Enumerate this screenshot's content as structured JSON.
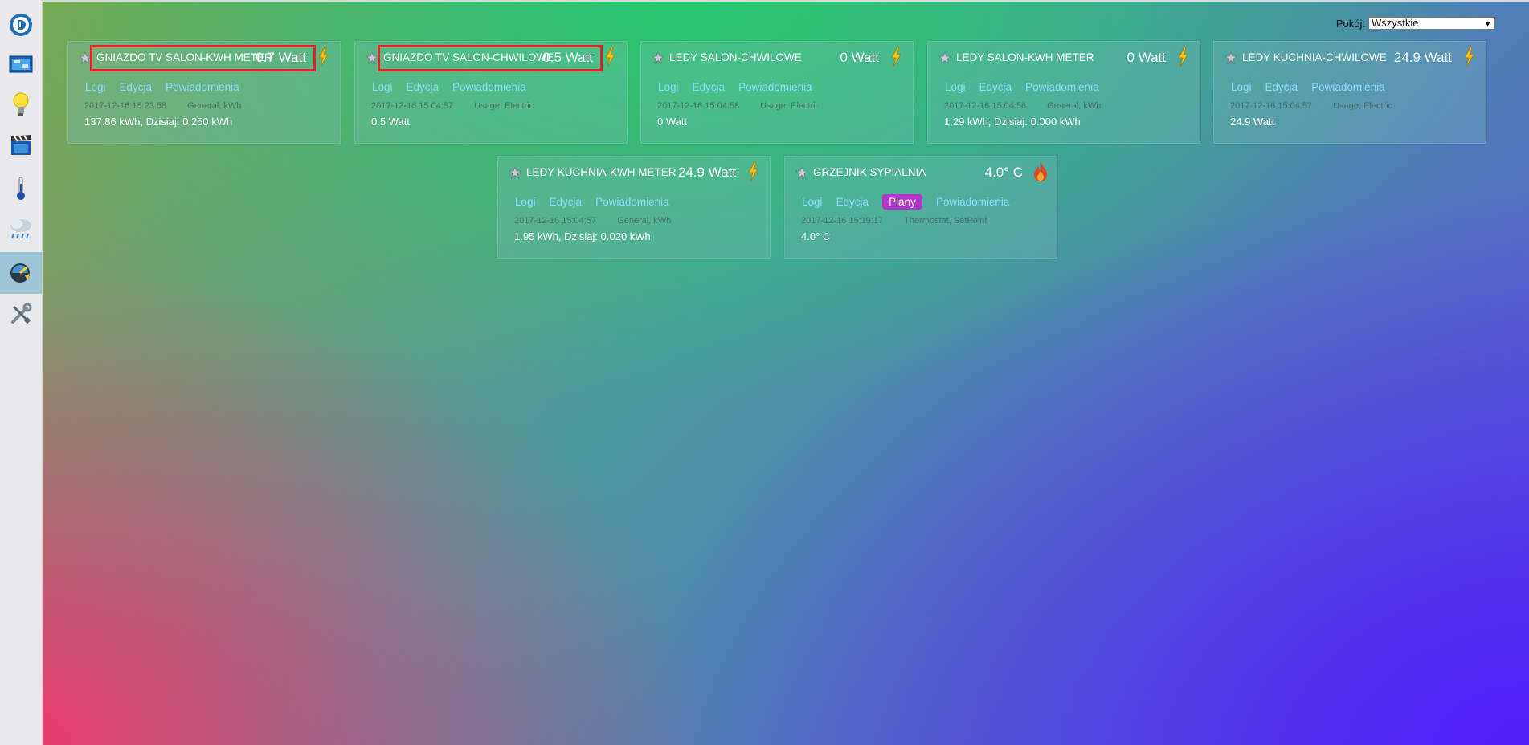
{
  "filter": {
    "label": "Pokój:",
    "selected": "Wszystkie"
  },
  "sidebar": {
    "items": [
      {
        "icon": "logo-icon"
      },
      {
        "icon": "dashboard-icon"
      },
      {
        "icon": "lightbulb-icon"
      },
      {
        "icon": "scenes-icon"
      },
      {
        "icon": "thermometer-icon"
      },
      {
        "icon": "weather-icon"
      },
      {
        "icon": "utility-icon",
        "active": true
      },
      {
        "icon": "setup-tools-icon"
      }
    ]
  },
  "links": {
    "logs": "Logi",
    "edit": "Edycja",
    "plans": "Plany",
    "notifications": "Powiadomienia"
  },
  "devices": [
    {
      "name": "GNIAZDO TV SALON-KWH METER",
      "value": "0.7 Watt",
      "icon": "lightning-icon",
      "timestamp": "2017-12-16 15:23:58",
      "type": "General, kWh",
      "summary": "137.86 kWh, Dzisiaj: 0.250 kWh"
    },
    {
      "name": "GNIAZDO TV SALON-CHWILOWE",
      "value": "0.5 Watt",
      "icon": "lightning-icon",
      "timestamp": "2017-12-16 15:04:57",
      "type": "Usage, Electric",
      "summary": "0.5 Watt"
    },
    {
      "name": "LEDY SALON-CHWILOWE",
      "value": "0 Watt",
      "icon": "lightning-icon",
      "timestamp": "2017-12-16 15:04:58",
      "type": "Usage, Electric",
      "summary": "0 Watt"
    },
    {
      "name": "LEDY SALON-KWH METER",
      "value": "0 Watt",
      "icon": "lightning-icon",
      "timestamp": "2017-12-16 15:04:56",
      "type": "General, kWh",
      "summary": "1.29 kWh, Dzisiaj: 0.000 kWh"
    },
    {
      "name": "LEDY KUCHNIA-CHWILOWE",
      "value": "24.9 Watt",
      "icon": "lightning-icon",
      "timestamp": "2017-12-16 15:04:57",
      "type": "Usage, Electric",
      "summary": "24.9 Watt"
    },
    {
      "name": "LEDY KUCHNIA-KWH METER",
      "value": "24.9 Watt",
      "icon": "lightning-icon",
      "timestamp": "2017-12-16 15:04:57",
      "type": "General, kWh",
      "summary": "1.95 kWh, Dzisiaj: 0.020 kWh"
    },
    {
      "name": "GRZEJNIK SYPIALNIA",
      "value": "4.0° C",
      "icon": "flame-icon",
      "timestamp": "2017-12-16 15:19:17",
      "type": "Thermostat, SetPoint",
      "summary": "4.0° C"
    }
  ]
}
